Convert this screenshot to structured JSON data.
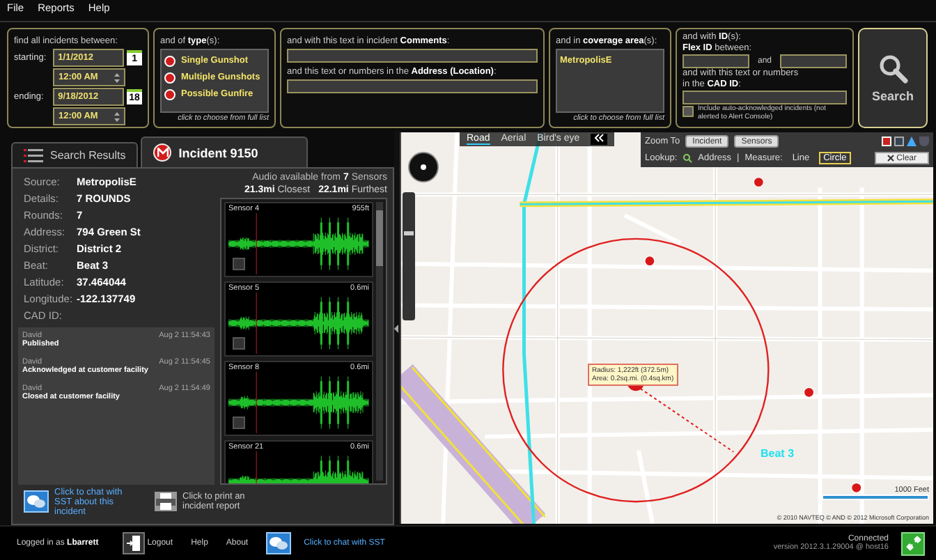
{
  "menu": [
    "File",
    "Reports",
    "Help"
  ],
  "date_filter": {
    "label": "find all incidents between:",
    "rows": [
      {
        "label": "starting:",
        "date": "1/1/2012",
        "time": "12:00 AM",
        "day": "1"
      },
      {
        "label": "ending:",
        "date": "9/18/2012",
        "time": "12:00 AM",
        "day": "18"
      }
    ]
  },
  "type_filter": {
    "label": "and of **type**(s):",
    "items": [
      "Single Gunshot",
      "Multiple Gunshots",
      "Possible Gunfire"
    ],
    "hint": "click to choose from full list"
  },
  "text_filter": {
    "comments_label": "and with this text in incident **Comments**:",
    "address_label": "and this text or numbers in the **Address (Location)**:"
  },
  "area_filter": {
    "label": "and in **coverage area**(s):",
    "items": [
      "MetropolisE"
    ],
    "hint": "click to choose from full list"
  },
  "id_filter": {
    "label": "and with **ID**(s):",
    "flex_label": "**Flex ID** between:",
    "and": "and",
    "cad_label_1": "and with this text or numbers",
    "cad_label_2": "in the **CAD ID**:",
    "checkbox": {
      "label": "Include auto-acknowledged incidents (not alerted to Alert Console)",
      "checked": false
    }
  },
  "search_button": "Search",
  "tabs": [
    {
      "label": "Search Results",
      "selected": false
    },
    {
      "label": "Incident 9150",
      "selected": true
    }
  ],
  "details": [
    {
      "label": "Source:",
      "value": "MetropolisE"
    },
    {
      "label": "Details:",
      "value": "7 ROUNDS"
    },
    {
      "label": "Rounds:",
      "value": "7"
    },
    {
      "label": "Address:",
      "value": "794 Green  St"
    },
    {
      "label": "District:",
      "value": "District 2"
    },
    {
      "label": "Beat:",
      "value": "Beat 3"
    },
    {
      "label": "Latitude:",
      "value": "37.464044"
    },
    {
      "label": "Longitude:",
      "value": "-122.137749"
    },
    {
      "label": "CAD ID:"
    }
  ],
  "log": [
    {
      "author": "David",
      "time": "Aug 2 11:54:43",
      "text": "Published"
    },
    {
      "author": "David",
      "time": "Aug 2 11:54:45",
      "text": "Acknowledged at customer facility"
    },
    {
      "author": "David",
      "time": "Aug 2 11:54:49",
      "text": "Closed at customer facility"
    }
  ],
  "audio": {
    "header": "Audio available from **7** Sensors",
    "closest": "**21.3mi** Closest",
    "furthest": "**22.1mi** Furthest"
  },
  "sensors": [
    {
      "name": "Sensor 4",
      "distance": "955ft"
    },
    {
      "name": "Sensor 5",
      "distance": "0.6mi"
    },
    {
      "name": "Sensor 8",
      "distance": "0.6mi"
    },
    {
      "name": "Sensor 21",
      "distance": "0.6mi"
    }
  ],
  "actions": [
    {
      "kind": "chat",
      "label": "Click to chat with SST about this incident"
    },
    {
      "kind": "print",
      "label": "Click to print an incident report"
    }
  ],
  "map": {
    "zoom_slider": {
      "level": 0.68
    },
    "types": [
      {
        "label": "Road",
        "selected": true
      },
      {
        "label": "Aerial",
        "selected": false
      },
      {
        "label": "Bird's eye",
        "selected": false
      }
    ],
    "zoom_to": "Zoom To",
    "zoom_buttons": [
      "Incident",
      "Sensors"
    ],
    "lookup": "Lookup:",
    "address": "Address",
    "separator": "|",
    "measure": "Measure:",
    "measure_options": [
      {
        "label": "Line",
        "selected": false
      },
      {
        "label": "Circle",
        "selected": true
      }
    ],
    "clear": "Clear",
    "radius": "Radius: 1,222ft (372.5m)",
    "area": "Area: 0.2sq.mi. (0.4sq.km)",
    "beat_label": "Beat 3",
    "scale": "1000 Feet",
    "copyright": "© 2010 NAVTEQ  © AND  © 2012 Microsoft Corporation"
  },
  "status_bar": {
    "logged_in": "Logged in as **Lbarrett**",
    "links": [
      "Logout",
      "Help",
      "About"
    ],
    "chat": "Click to chat with SST",
    "connection": "Connected",
    "version": "version 2012.3.1.29004 @ host16"
  }
}
